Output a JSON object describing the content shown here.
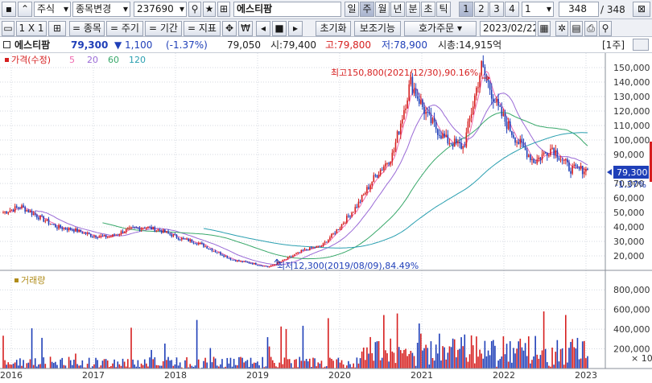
{
  "toolbar1": {
    "market": "주식",
    "stock_change": "종목변경",
    "code": "237690",
    "name": "에스티팜",
    "periods": [
      "일",
      "주",
      "월",
      "년",
      "분",
      "초",
      "틱"
    ],
    "active_period": "주",
    "unit_buttons": [
      "1",
      "2",
      "3",
      "4"
    ],
    "unit_value": "1",
    "count": "348",
    "total": "/ 348"
  },
  "toolbar2": {
    "layout": "1 X 1",
    "item": "= 종목",
    "cycle": "= 주기",
    "range": "= 기간",
    "indicator": "= 지표",
    "reset": "초기화",
    "aux": "보조기능",
    "order": "호가주문",
    "date": "2023/02/22"
  },
  "info": {
    "name": "에스티팜",
    "price": "79,300",
    "change": "▼ 1,100",
    "rate": "(-1.37%)",
    "volume": "79,050",
    "open": "시:79,400",
    "high": "고:79,800",
    "low": "저:78,900",
    "mcap": "시총:14,915억",
    "period_tag": "[1주]"
  },
  "legend": {
    "price": "가격(수정)",
    "ma": [
      {
        "label": "5",
        "color": "#f06ab0"
      },
      {
        "label": "20",
        "color": "#9a6ad6"
      },
      {
        "label": "60",
        "color": "#38a86a"
      },
      {
        "label": "120",
        "color": "#2a9fb0"
      }
    ],
    "volume": "거래량"
  },
  "annotations": {
    "high": "최고150,800(2021/12/30),90.16%",
    "low": "최저12,300(2019/08/09),84.49%"
  },
  "price_tag": {
    "value": "79,300",
    "rate": "-1.37%"
  },
  "chart_data": {
    "type": "line",
    "x": [
      "2016",
      "2017",
      "2018",
      "2019",
      "2020",
      "2021",
      "2022",
      "2023"
    ],
    "price_axis": [
      "150,000",
      "140,000",
      "130,000",
      "120,000",
      "110,000",
      "100,000",
      "90,000",
      "80,000",
      "70,000",
      "60,000",
      "50,000",
      "40,000",
      "30,000",
      "20,000"
    ],
    "price_ylim": [
      10000,
      160000
    ],
    "volume_axis": [
      "800,000",
      "600,000",
      "400,000",
      "200,000"
    ],
    "volume_unit": "× 10",
    "series": [
      {
        "name": "가격(수정)",
        "values": [
          50000,
          54000,
          47000,
          40000,
          38000,
          34000,
          33000,
          38000,
          40000,
          37000,
          32000,
          29000,
          23000,
          17000,
          15000,
          12300,
          18000,
          24000,
          27000,
          40000,
          55000,
          75000,
          90000,
          140000,
          115000,
          100000,
          95000,
          150800,
          120000,
          100000,
          85000,
          95000,
          80000,
          79300
        ]
      }
    ]
  },
  "colors": {
    "up": "#d61f1f",
    "down": "#1f3fb8",
    "ma5": "#f06ab0",
    "ma20": "#9a6ad6",
    "ma60": "#38a86a",
    "ma120": "#2a9fb0"
  }
}
